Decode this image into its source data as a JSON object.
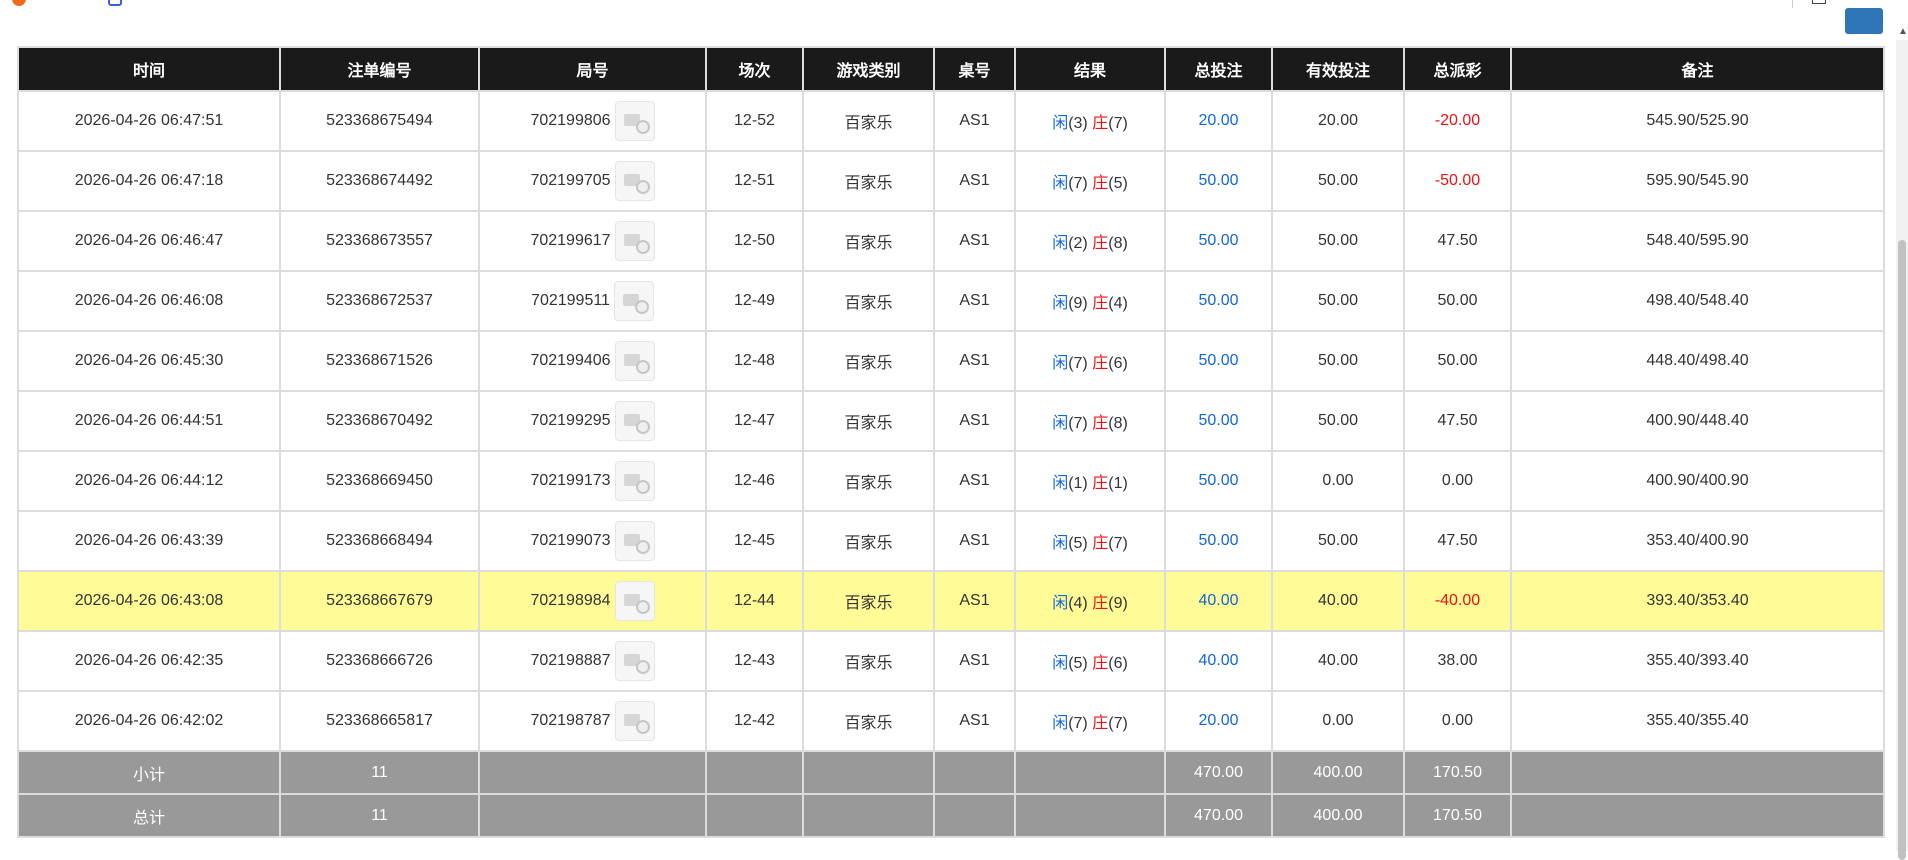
{
  "colors": {
    "header_bg": "#1a1a1a",
    "highlight_row": "#fffb96",
    "summary_bg": "#999999",
    "player_blue": "#1166dd",
    "banker_red": "#ee1111"
  },
  "columns": [
    "时间",
    "注单编号",
    "局号",
    "场次",
    "游戏类别",
    "桌号",
    "结果",
    "总投注",
    "有效投注",
    "总派彩",
    "备注"
  ],
  "rows": [
    {
      "time": "2026-04-26 06:47:51",
      "bet_id": "523368675494",
      "round_no": "702199806",
      "session": "12-52",
      "game": "百家乐",
      "table": "AS1",
      "player_label": "闲",
      "player_score": "(3)",
      "banker_label": "庄",
      "banker_score": "(7)",
      "total_bet": "20.00",
      "valid_bet": "20.00",
      "payout": "-20.00",
      "payout_neg": true,
      "note": "545.90/525.90"
    },
    {
      "time": "2026-04-26 06:47:18",
      "bet_id": "523368674492",
      "round_no": "702199705",
      "session": "12-51",
      "game": "百家乐",
      "table": "AS1",
      "player_label": "闲",
      "player_score": "(7)",
      "banker_label": "庄",
      "banker_score": "(5)",
      "total_bet": "50.00",
      "valid_bet": "50.00",
      "payout": "-50.00",
      "payout_neg": true,
      "note": "595.90/545.90"
    },
    {
      "time": "2026-04-26 06:46:47",
      "bet_id": "523368673557",
      "round_no": "702199617",
      "session": "12-50",
      "game": "百家乐",
      "table": "AS1",
      "player_label": "闲",
      "player_score": "(2)",
      "banker_label": "庄",
      "banker_score": "(8)",
      "total_bet": "50.00",
      "valid_bet": "50.00",
      "payout": "47.50",
      "payout_neg": false,
      "note": "548.40/595.90"
    },
    {
      "time": "2026-04-26 06:46:08",
      "bet_id": "523368672537",
      "round_no": "702199511",
      "session": "12-49",
      "game": "百家乐",
      "table": "AS1",
      "player_label": "闲",
      "player_score": "(9)",
      "banker_label": "庄",
      "banker_score": "(4)",
      "total_bet": "50.00",
      "valid_bet": "50.00",
      "payout": "50.00",
      "payout_neg": false,
      "note": "498.40/548.40"
    },
    {
      "time": "2026-04-26 06:45:30",
      "bet_id": "523368671526",
      "round_no": "702199406",
      "session": "12-48",
      "game": "百家乐",
      "table": "AS1",
      "player_label": "闲",
      "player_score": "(7)",
      "banker_label": "庄",
      "banker_score": "(6)",
      "total_bet": "50.00",
      "valid_bet": "50.00",
      "payout": "50.00",
      "payout_neg": false,
      "note": "448.40/498.40"
    },
    {
      "time": "2026-04-26 06:44:51",
      "bet_id": "523368670492",
      "round_no": "702199295",
      "session": "12-47",
      "game": "百家乐",
      "table": "AS1",
      "player_label": "闲",
      "player_score": "(7)",
      "banker_label": "庄",
      "banker_score": "(8)",
      "total_bet": "50.00",
      "valid_bet": "50.00",
      "payout": "47.50",
      "payout_neg": false,
      "note": "400.90/448.40"
    },
    {
      "time": "2026-04-26 06:44:12",
      "bet_id": "523368669450",
      "round_no": "702199173",
      "session": "12-46",
      "game": "百家乐",
      "table": "AS1",
      "player_label": "闲",
      "player_score": "(1)",
      "banker_label": "庄",
      "banker_score": "(1)",
      "total_bet": "50.00",
      "valid_bet": "0.00",
      "payout": "0.00",
      "payout_neg": false,
      "note": "400.90/400.90"
    },
    {
      "time": "2026-04-26 06:43:39",
      "bet_id": "523368668494",
      "round_no": "702199073",
      "session": "12-45",
      "game": "百家乐",
      "table": "AS1",
      "player_label": "闲",
      "player_score": "(5)",
      "banker_label": "庄",
      "banker_score": "(7)",
      "total_bet": "50.00",
      "valid_bet": "50.00",
      "payout": "47.50",
      "payout_neg": false,
      "note": "353.40/400.90"
    },
    {
      "time": "2026-04-26 06:43:08",
      "bet_id": "523368667679",
      "round_no": "702198984",
      "session": "12-44",
      "game": "百家乐",
      "table": "AS1",
      "player_label": "闲",
      "player_score": "(4)",
      "banker_label": "庄",
      "banker_score": "(9)",
      "total_bet": "40.00",
      "valid_bet": "40.00",
      "payout": "-40.00",
      "payout_neg": true,
      "note": "393.40/353.40",
      "highlight": true
    },
    {
      "time": "2026-04-26 06:42:35",
      "bet_id": "523368666726",
      "round_no": "702198887",
      "session": "12-43",
      "game": "百家乐",
      "table": "AS1",
      "player_label": "闲",
      "player_score": "(5)",
      "banker_label": "庄",
      "banker_score": "(6)",
      "total_bet": "40.00",
      "valid_bet": "40.00",
      "payout": "38.00",
      "payout_neg": false,
      "note": "355.40/393.40"
    },
    {
      "time": "2026-04-26 06:42:02",
      "bet_id": "523368665817",
      "round_no": "702198787",
      "session": "12-42",
      "game": "百家乐",
      "table": "AS1",
      "player_label": "闲",
      "player_score": "(7)",
      "banker_label": "庄",
      "banker_score": "(7)",
      "total_bet": "20.00",
      "valid_bet": "0.00",
      "payout": "0.00",
      "payout_neg": false,
      "note": "355.40/355.40"
    }
  ],
  "subtotal": {
    "label": "小计",
    "count": "11",
    "total_bet": "470.00",
    "valid_bet": "400.00",
    "payout": "170.50"
  },
  "total": {
    "label": "总计",
    "count": "11",
    "total_bet": "470.00",
    "valid_bet": "400.00",
    "payout": "170.50"
  },
  "icons": {
    "video": "video-replay-icon",
    "scroll_up": "▲"
  }
}
